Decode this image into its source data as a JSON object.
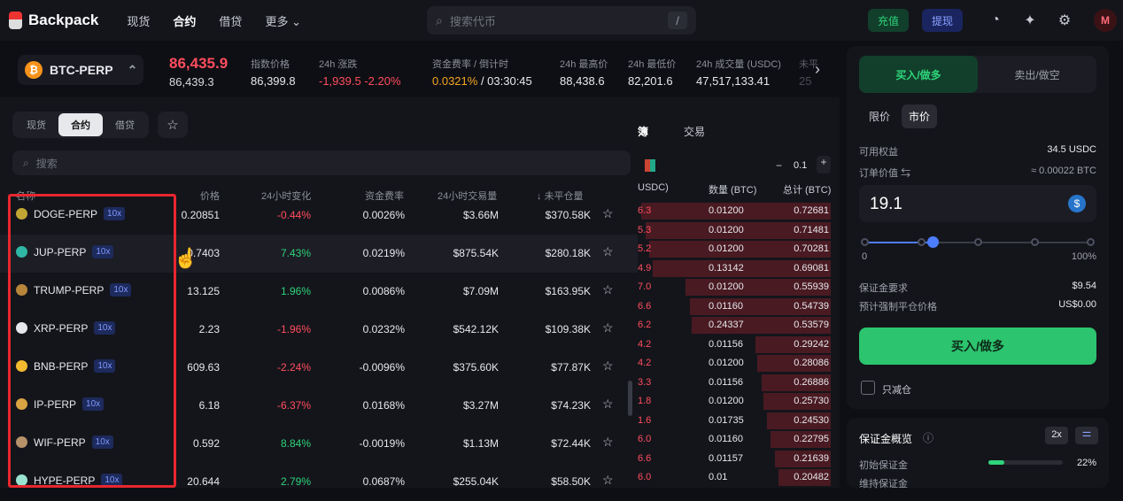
{
  "app": {
    "name": "Backpack"
  },
  "nav": {
    "spot": "现货",
    "futures": "合约",
    "lending": "借贷",
    "more": "更多"
  },
  "search": {
    "placeholder": "搜索代币",
    "shortcut": "/"
  },
  "actions": {
    "deposit": "充值",
    "withdraw": "提现"
  },
  "user": {
    "avatar_letter": "M"
  },
  "ticker": {
    "symbol": "BTC-PERP",
    "last_price": "86,435.9",
    "mark_price": "86,439.3",
    "stats": [
      {
        "label": "指数价格",
        "value": "86,399.8",
        "tone": "neutral"
      },
      {
        "label": "24h 涨跌",
        "value": "-1,939.5 -2.20%",
        "tone": "red"
      },
      {
        "label": "资金费率 / 倒计时",
        "value": "0.0321%",
        "value2": " / 03:30:45",
        "tone": "amber"
      },
      {
        "label": "24h 最高价",
        "value": "88,438.6",
        "tone": "neutral"
      },
      {
        "label": "24h 最低价",
        "value": "82,201.6",
        "tone": "neutral"
      },
      {
        "label": "24h 成交量 (USDC)",
        "value": "47,517,133.41",
        "tone": "neutral"
      },
      {
        "label": "未平",
        "value": "25",
        "tone": "neutral"
      }
    ]
  },
  "market_panel": {
    "tabs": [
      "现货",
      "合约",
      "借贷"
    ],
    "active_tab": "合约",
    "search_placeholder": "搜索",
    "columns": [
      "名称",
      "价格",
      "24小时变化",
      "资金费率",
      "24小时交易量",
      "未平仓量"
    ],
    "rows": [
      {
        "symbol": "DOGE-PERP",
        "leverage": "10x",
        "price": "0.20851",
        "change": "-0.44%",
        "funding": "0.0026%",
        "volume": "$3.66M",
        "open_interest": "$370.58K",
        "icon_color": "#c2a633"
      },
      {
        "symbol": "JUP-PERP",
        "leverage": "10x",
        "price": "0.7403",
        "change": "7.43%",
        "funding": "0.0219%",
        "volume": "$875.54K",
        "open_interest": "$280.18K",
        "icon_color": "#2fb6a6"
      },
      {
        "symbol": "TRUMP-PERP",
        "leverage": "10x",
        "price": "13.125",
        "change": "1.96%",
        "funding": "0.0086%",
        "volume": "$7.09M",
        "open_interest": "$163.95K",
        "icon_color": "#b8863b"
      },
      {
        "symbol": "XRP-PERP",
        "leverage": "10x",
        "price": "2.23",
        "change": "-1.96%",
        "funding": "0.0232%",
        "volume": "$542.12K",
        "open_interest": "$109.38K",
        "icon_color": "#e6e8ec"
      },
      {
        "symbol": "BNB-PERP",
        "leverage": "10x",
        "price": "609.63",
        "change": "-2.24%",
        "funding": "-0.0096%",
        "volume": "$375.60K",
        "open_interest": "$77.87K",
        "icon_color": "#f3ba2f"
      },
      {
        "symbol": "IP-PERP",
        "leverage": "10x",
        "price": "6.18",
        "change": "-6.37%",
        "funding": "0.0168%",
        "volume": "$3.27M",
        "open_interest": "$74.23K",
        "icon_color": "#d9a441"
      },
      {
        "symbol": "WIF-PERP",
        "leverage": "10x",
        "price": "0.592",
        "change": "8.84%",
        "funding": "-0.0019%",
        "volume": "$1.13M",
        "open_interest": "$72.44K",
        "icon_color": "#b79268"
      },
      {
        "symbol": "HYPE-PERP",
        "leverage": "10x",
        "price": "20.644",
        "change": "2.79%",
        "funding": "0.0687%",
        "volume": "$255.04K",
        "open_interest": "$58.50K",
        "icon_color": "#9be3d1"
      }
    ]
  },
  "order_book": {
    "tabs": [
      "簿",
      "交易"
    ],
    "step": "0.1",
    "columns": [
      "USDC)",
      "数量 (BTC)",
      "总计 (BTC)"
    ],
    "rows": [
      {
        "price": "6.3",
        "qty": "0.01200",
        "total": "0.72681",
        "depth": 0.98
      },
      {
        "price": "5.3",
        "qty": "0.01200",
        "total": "0.71481",
        "depth": 0.96
      },
      {
        "price": "5.2",
        "qty": "0.01200",
        "total": "0.70281",
        "depth": 0.94
      },
      {
        "price": "4.9",
        "qty": "0.13142",
        "total": "0.69081",
        "depth": 0.92
      },
      {
        "price": "7.0",
        "qty": "0.01200",
        "total": "0.55939",
        "depth": 0.75
      },
      {
        "price": "6.6",
        "qty": "0.01160",
        "total": "0.54739",
        "depth": 0.73
      },
      {
        "price": "6.2",
        "qty": "0.24337",
        "total": "0.53579",
        "depth": 0.72
      },
      {
        "price": "4.2",
        "qty": "0.01156",
        "total": "0.29242",
        "depth": 0.39
      },
      {
        "price": "4.2",
        "qty": "0.01200",
        "total": "0.28086",
        "depth": 0.38
      },
      {
        "price": "3.3",
        "qty": "0.01156",
        "total": "0.26886",
        "depth": 0.36
      },
      {
        "price": "1.8",
        "qty": "0.01200",
        "total": "0.25730",
        "depth": 0.35
      },
      {
        "price": "1.6",
        "qty": "0.01735",
        "total": "0.24530",
        "depth": 0.33
      },
      {
        "price": "6.0",
        "qty": "0.01160",
        "total": "0.22795",
        "depth": 0.31
      },
      {
        "price": "6.6",
        "qty": "0.01157",
        "total": "0.21639",
        "depth": 0.29
      },
      {
        "price": "6.0",
        "qty": "0.01",
        "total": "0.20482",
        "depth": 0.27
      }
    ]
  },
  "trade": {
    "buy_tab": "买入/做多",
    "sell_tab": "卖出/做空",
    "order_types": [
      "限价",
      "市价"
    ],
    "active_order_type": "市价",
    "available_label": "可用权益",
    "available_value": "34.5 USDC",
    "order_value_label": "订单价值",
    "order_value": "≈ 0.00022 BTC",
    "amount": "19.1",
    "slider_min": "0",
    "slider_max": "100%",
    "slider_level": 0.3,
    "margin_req_label": "保证金要求",
    "margin_req_value": "$9.54",
    "liq_label": "预计强制平仓价格",
    "liq_value": "US$0.00",
    "submit": "买入/做多",
    "reduce_only": "只减仓"
  },
  "margin": {
    "title": "保证金概览",
    "leverage": "2x",
    "initial_label": "初始保证金",
    "initial_value": "22%",
    "initial_fraction": 0.22,
    "maint_label": "维持保证金"
  }
}
